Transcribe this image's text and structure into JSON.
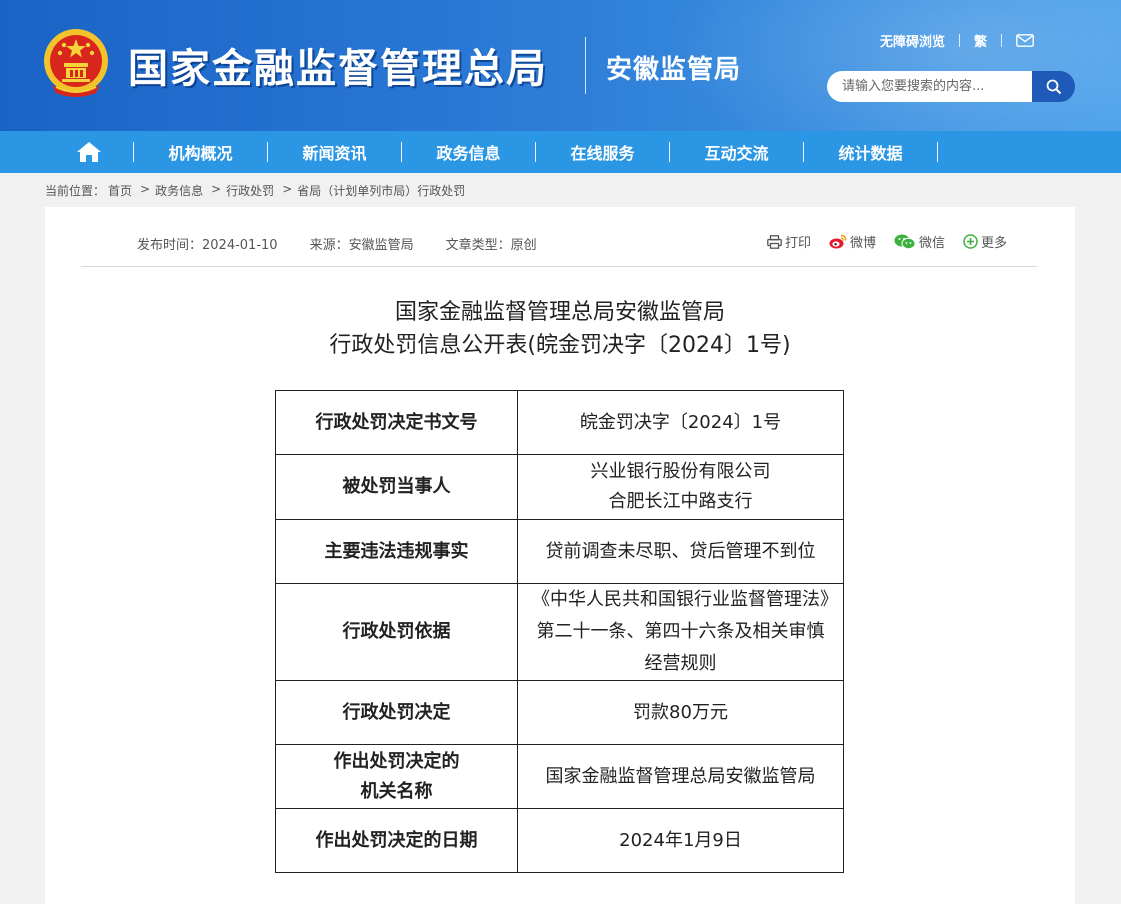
{
  "header": {
    "site_title": "国家金融监督管理总局",
    "sub_title": "安徽监管局",
    "accessibility_link": "无障碍浏览",
    "traditional_link": "繁",
    "search_placeholder": "请输入您要搜索的内容..."
  },
  "nav": {
    "items": [
      {
        "label": "机构概况"
      },
      {
        "label": "新闻资讯"
      },
      {
        "label": "政务信息"
      },
      {
        "label": "在线服务"
      },
      {
        "label": "互动交流"
      },
      {
        "label": "统计数据"
      }
    ]
  },
  "breadcrumb": {
    "prefix": "当前位置：",
    "items": [
      "首页",
      "政务信息",
      "行政处罚",
      "省局（计划单列市局）行政处罚"
    ]
  },
  "article": {
    "publish_time": "发布时间：2024-01-10",
    "source": "来源：安徽监管局",
    "doc_type": "文章类型：原创",
    "share": {
      "print": "打印",
      "weibo": "微博",
      "wechat": "微信",
      "more": "更多"
    },
    "title_line1": "国家金融监督管理总局安徽监管局",
    "title_line2": "行政处罚信息公开表(皖金罚决字〔2024〕1号)",
    "table": [
      {
        "key": "行政处罚决定书文号",
        "value": "皖金罚决字〔2024〕1号"
      },
      {
        "key": "被处罚当事人",
        "value": "兴业银行股份有限公司\n合肥长江中路支行"
      },
      {
        "key": "主要违法违规事实",
        "value": "贷前调查未尽职、贷后管理不到位"
      },
      {
        "key": "行政处罚依据",
        "value": "《中华人民共和国银行业监督管理法》第二十一条、第四十六条及相关审慎经营规则"
      },
      {
        "key": "行政处罚决定",
        "value": "罚款80万元"
      },
      {
        "key": "作出处罚决定的\n机关名称",
        "value": "国家金融监督管理总局安徽监管局"
      },
      {
        "key": "作出处罚决定的日期",
        "value": "2024年1月9日"
      }
    ]
  },
  "colors": {
    "header_blue": "#1a63c6",
    "nav_blue": "#2a96e4",
    "search_button": "#1f5ab8"
  },
  "icons": [
    "national-emblem-icon",
    "mail-icon",
    "search-icon",
    "home-icon",
    "print-icon",
    "weibo-icon",
    "wechat-icon",
    "plus-circle-icon"
  ]
}
